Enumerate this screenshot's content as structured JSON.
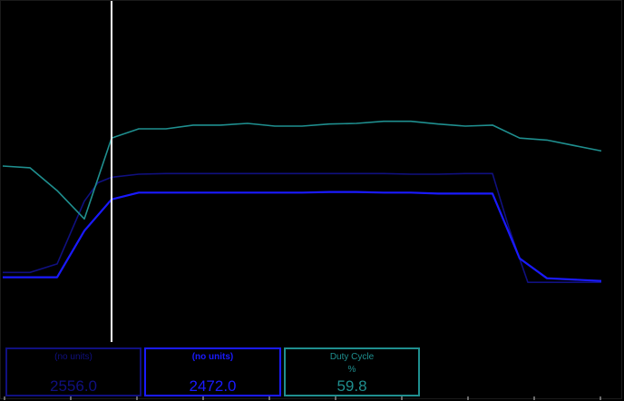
{
  "colors": {
    "background": "#000000",
    "cursor": "#ffffff",
    "trace_dark_blue": "#101080",
    "trace_blue": "#1a1aff",
    "trace_teal": "#1f8f8f"
  },
  "chart_data": {
    "type": "line",
    "title": "",
    "xlabel": "",
    "ylabel": "",
    "xlim": [
      0,
      22
    ],
    "ylim": [
      0,
      100
    ],
    "grid": false,
    "cursor_x": 4,
    "series": [
      {
        "color": "#101080",
        "x": [
          0,
          1,
          2,
          3,
          3.5,
          4,
          5,
          6,
          7,
          8,
          9,
          10,
          11,
          12,
          13,
          14,
          15,
          16,
          17,
          18,
          18.6,
          19.3,
          20,
          22
        ],
        "y": [
          20.4,
          20.4,
          22.9,
          41.3,
          46.7,
          48.3,
          49.2,
          49.4,
          49.4,
          49.4,
          49.4,
          49.4,
          49.4,
          49.4,
          49.4,
          49.4,
          49.2,
          49.2,
          49.4,
          49.4,
          33.6,
          17.5,
          17.5,
          17.5
        ]
      },
      {
        "color": "#1a1aff",
        "x": [
          0,
          1,
          2,
          3,
          4,
          5,
          6,
          7,
          8,
          9,
          10,
          11,
          12,
          13,
          14,
          15,
          16,
          17,
          18,
          19,
          20,
          22
        ],
        "y": [
          19.0,
          19.0,
          19.0,
          32.6,
          41.8,
          43.8,
          43.8,
          43.8,
          43.8,
          43.8,
          43.8,
          43.8,
          44.0,
          44.0,
          43.8,
          43.8,
          43.5,
          43.5,
          43.5,
          24.5,
          18.7,
          17.9
        ]
      },
      {
        "color": "#1f8f8f",
        "x": [
          0,
          1,
          2,
          3,
          4,
          5,
          6,
          7,
          8,
          9,
          10,
          11,
          12,
          13,
          14,
          15,
          16,
          17,
          18,
          19,
          20,
          22
        ],
        "y": [
          51.6,
          51.1,
          44.4,
          36.1,
          59.8,
          62.5,
          62.5,
          63.6,
          63.6,
          64.1,
          63.3,
          63.3,
          63.9,
          64.1,
          64.7,
          64.7,
          63.9,
          63.3,
          63.6,
          59.8,
          59.2,
          56.0
        ]
      }
    ]
  },
  "readouts": [
    {
      "name": "(no units)",
      "unit": "",
      "value": "2556.0",
      "color": "#101080"
    },
    {
      "name": "(no units)",
      "unit": "",
      "value": "2472.0",
      "color": "#1a1aff"
    },
    {
      "name": "Duty Cycle",
      "unit": "%",
      "value": "59.8",
      "color": "#1f8f8f"
    }
  ]
}
